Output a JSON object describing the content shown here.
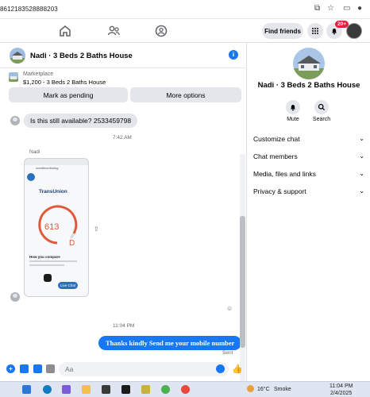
{
  "browser": {
    "url_text": "8612183528888203"
  },
  "topnav": {
    "find_friends_label": "Find friends",
    "notification_badge": "20+"
  },
  "chat": {
    "title": "Nadi · 3 Beds 2 Baths House",
    "marketplace": {
      "label": "Marketplace",
      "price_line": "$1,200 - 3 Beds 2 Baths House"
    },
    "buttons": {
      "mark_pending": "Mark as pending",
      "more_options": "More options"
    },
    "messages": {
      "first_incoming": "Is this still available? 2533459798",
      "time_1": "7:42 AM",
      "sender_name": "Nadi",
      "time_2": "11:04 PM",
      "outgoing": "Thanks kindly Send me your mobile number",
      "sent_status": "Sent"
    },
    "attachment": {
      "site": "creditmonitoring",
      "brand": "TransUnion",
      "score": "613",
      "grade": "D",
      "compare": "How you compare",
      "live_chat": "Live Chat"
    },
    "composer_placeholder": "Aa"
  },
  "details": {
    "title": "Nadi · 3 Beds 2 Baths House",
    "actions": {
      "mute": "Mute",
      "search": "Search"
    },
    "sections": {
      "customize": "Customize chat",
      "members": "Chat members",
      "media": "Media, files and links",
      "privacy": "Privacy & support"
    }
  },
  "taskbar": {
    "weather": "16°C",
    "weather_desc": "Smoke",
    "time": "11:04 PM",
    "date": "2/4/2025"
  },
  "colors": {
    "accent": "#1877f2",
    "bubble_in": "#e4e6eb",
    "badge": "#e41e3f"
  },
  "icons": [
    "home-icon",
    "people-icon",
    "groups-icon",
    "grid-menu-icon",
    "bell-icon",
    "info-icon",
    "mute-bell-icon",
    "search-icon",
    "chevron-down-icon",
    "plus-icon",
    "image-icon",
    "sticker-icon",
    "gif-icon",
    "emoji-icon",
    "thumbs-up-icon",
    "share-icon"
  ]
}
